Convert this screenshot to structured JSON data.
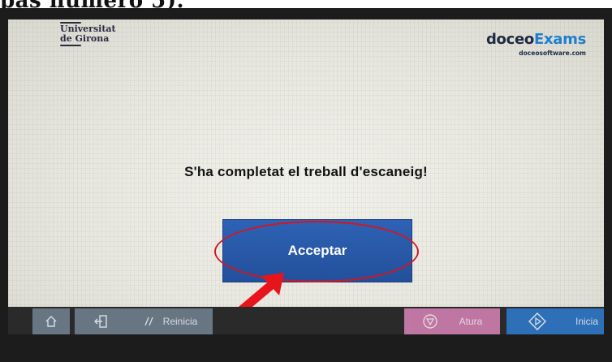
{
  "caption": {
    "text": "pas número 5)."
  },
  "header": {
    "left_logo": {
      "line1": "Universitat",
      "line2": "de Girona"
    },
    "right_logo": {
      "brand_part1": "doceo",
      "brand_part2": "Exams",
      "url": "doceosoftware.com"
    }
  },
  "dialog": {
    "message": "S'ha completat el treball d'escaneig!",
    "accept_label": "Acceptar"
  },
  "bottom_bar": {
    "home": {
      "icon": "home-icon"
    },
    "logout": {
      "icon": "logout-icon"
    },
    "reset": {
      "icon": "reset-icon",
      "label": "Reinicia"
    },
    "stop": {
      "icon": "stop-icon",
      "label": "Atura"
    },
    "start": {
      "icon": "start-icon",
      "label": "Inicia"
    }
  },
  "colors": {
    "accept_button": "#2a5aaa",
    "highlight": "#d8141e",
    "stop_button": "#d07fb0",
    "start_button": "#2f78c8",
    "nav_button": "#6f7f8e"
  }
}
